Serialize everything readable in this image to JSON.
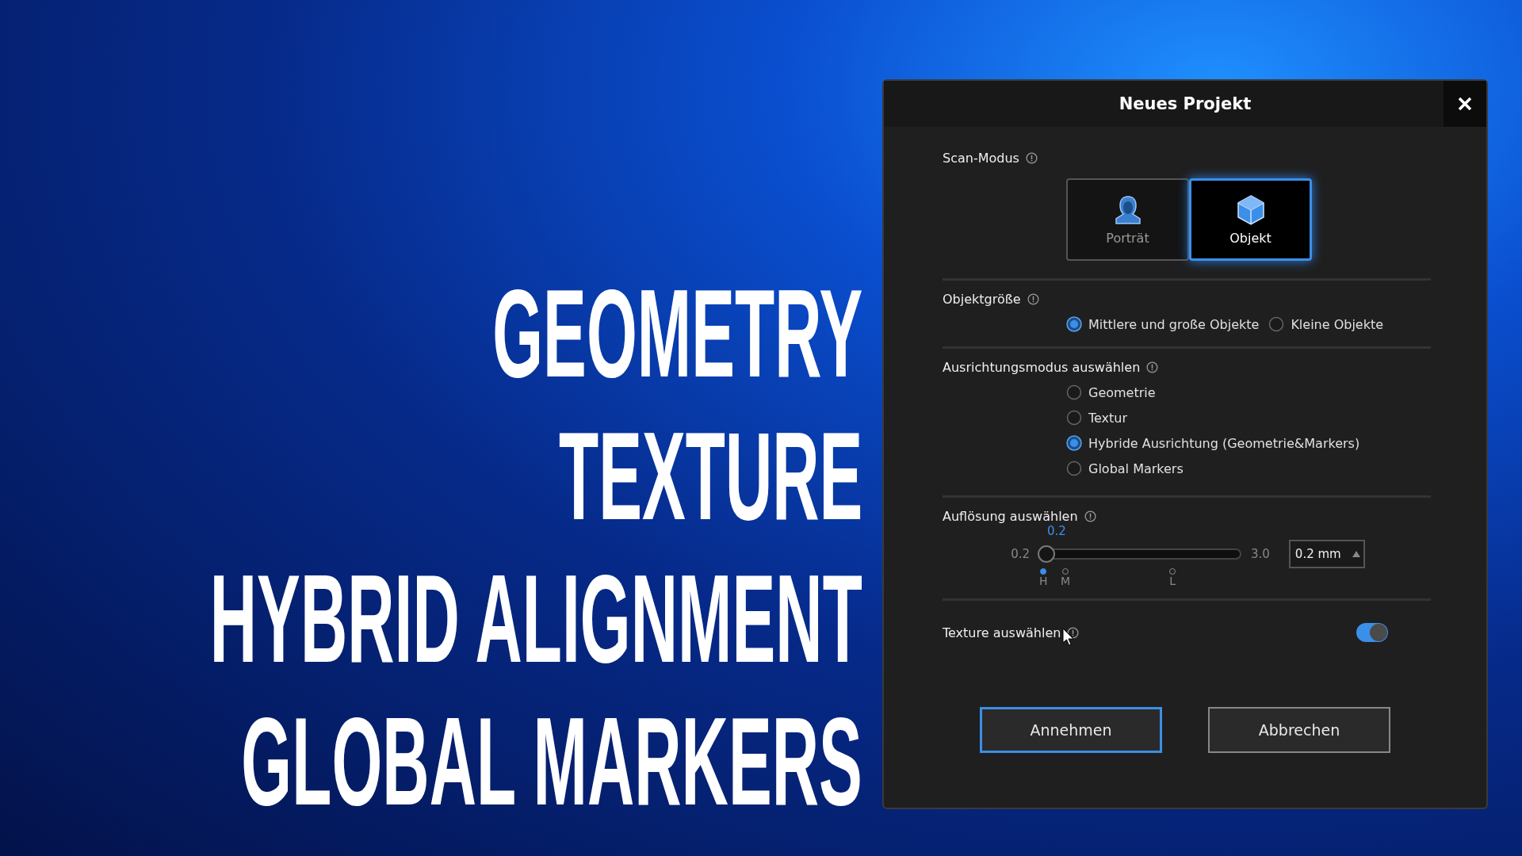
{
  "headlines": [
    "GEOMETRY",
    "TEXTURE",
    "HYBRID ALIGNMENT",
    "GLOBAL MARKERS"
  ],
  "dialog": {
    "title": "Neues Projekt",
    "scan_mode": {
      "label": "Scan-Modus",
      "options": [
        {
          "label": "Porträt",
          "kind": "portrait",
          "selected": false
        },
        {
          "label": "Objekt",
          "kind": "object",
          "selected": true
        }
      ]
    },
    "object_size": {
      "label": "Objektgröße",
      "options": [
        {
          "label": "Mittlere und große Objekte",
          "selected": true
        },
        {
          "label": "Kleine Objekte",
          "selected": false
        }
      ]
    },
    "alignment_mode": {
      "label": "Ausrichtungsmodus auswählen",
      "options": [
        {
          "label": "Geometrie",
          "selected": false
        },
        {
          "label": "Textur",
          "selected": false
        },
        {
          "label": "Hybride Ausrichtung (Geometrie&Markers)",
          "selected": true
        },
        {
          "label": "Global Markers",
          "selected": false
        }
      ]
    },
    "resolution": {
      "label": "Auflösung auswählen",
      "value_label": "0.2",
      "min": "0.2",
      "max": "3.0",
      "level": 0,
      "input": "0.2 mm",
      "ticks": [
        {
          "label": "H",
          "selected": true
        },
        {
          "label": "M",
          "selected": false
        },
        {
          "label": "L",
          "selected": false
        }
      ]
    },
    "texture": {
      "label": "Texture auswählen",
      "on": true
    },
    "buttons": [
      {
        "label": "Annehmen",
        "focused": true
      },
      {
        "label": "Abbrechen",
        "focused": false
      }
    ]
  }
}
